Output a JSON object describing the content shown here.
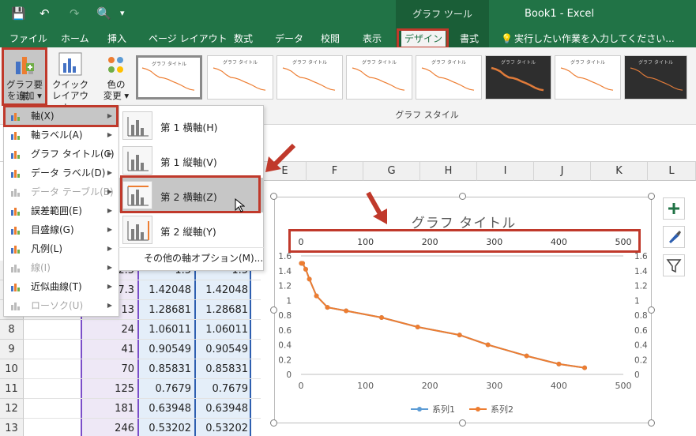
{
  "app": {
    "chart_tools_label": "グラフ ツール",
    "window_title": "Book1 - Excel",
    "qat_save": "💾",
    "qat_undo": "↶",
    "qat_redo": "↷",
    "qat_preview": "🔍",
    "qat_more": "▾"
  },
  "tabs": [
    {
      "label": "ファイル"
    },
    {
      "label": "ホーム"
    },
    {
      "label": "挿入"
    },
    {
      "label": "ページ レイアウト"
    },
    {
      "label": "数式"
    },
    {
      "label": "データ"
    },
    {
      "label": "校閲"
    },
    {
      "label": "表示"
    },
    {
      "label": "デザイン"
    },
    {
      "label": "書式"
    }
  ],
  "tell_me": "実行したい作業を入力してください...",
  "ribbon": {
    "add_element_line1": "グラフ要素",
    "add_element_line2": "を追加",
    "quick_layout_line1": "クイック",
    "quick_layout_line2": "レイアウト",
    "change_color_line1": "色の",
    "change_color_line2": "変更",
    "chart_styles_group": "グラフ スタイル",
    "thumb_title": "グラフ タイトル"
  },
  "menu": {
    "items": [
      {
        "label": "軸(X)",
        "disabled": false
      },
      {
        "label": "軸ラベル(A)",
        "disabled": false
      },
      {
        "label": "グラフ タイトル(C)",
        "disabled": false
      },
      {
        "label": "データ ラベル(D)",
        "disabled": false
      },
      {
        "label": "データ テーブル(B)",
        "disabled": true
      },
      {
        "label": "誤差範囲(E)",
        "disabled": false
      },
      {
        "label": "目盛線(G)",
        "disabled": false
      },
      {
        "label": "凡例(L)",
        "disabled": false
      },
      {
        "label": "線(I)",
        "disabled": true
      },
      {
        "label": "近似曲線(T)",
        "disabled": false
      },
      {
        "label": "ローソク(U)",
        "disabled": true
      }
    ]
  },
  "submenu": {
    "items": [
      {
        "label": "第 1 横軸(H)"
      },
      {
        "label": "第 1 縦軸(V)"
      },
      {
        "label": "第 2 横軸(Z)"
      },
      {
        "label": "第 2 縦軸(Y)"
      }
    ],
    "more_options": "その他の軸オプション(M)..."
  },
  "sheet": {
    "columns": [
      "E",
      "F",
      "G",
      "H",
      "I",
      "J",
      "K",
      "L"
    ],
    "rows": [
      {
        "num": "",
        "b": "2.5",
        "c": "1.5",
        "d": "1.5"
      },
      {
        "num": "",
        "b": "7.3",
        "c": "1.42048",
        "d": "1.42048"
      },
      {
        "num": "",
        "b": "13",
        "c": "1.28681",
        "d": "1.28681"
      },
      {
        "num": "8",
        "b": "24",
        "c": "1.06011",
        "d": "1.06011"
      },
      {
        "num": "9",
        "b": "41",
        "c": "0.90549",
        "d": "0.90549"
      },
      {
        "num": "10",
        "b": "70",
        "c": "0.85831",
        "d": "0.85831"
      },
      {
        "num": "11",
        "b": "125",
        "c": "0.7679",
        "d": "0.7679"
      },
      {
        "num": "12",
        "b": "181",
        "c": "0.63948",
        "d": "0.63948"
      },
      {
        "num": "13",
        "b": "246",
        "c": "0.53202",
        "d": "0.53202"
      }
    ]
  },
  "colors": {
    "excel_green": "#217346",
    "highlight_red": "#c0392b",
    "series1": "#5b9bd5",
    "series2": "#ed7d31"
  },
  "chart_data": {
    "type": "scatter",
    "title": "グラフ タイトル",
    "x_ticks_bottom": [
      "0",
      "100",
      "200",
      "300",
      "400",
      "500"
    ],
    "x_ticks_top": [
      "0",
      "100",
      "200",
      "300",
      "400",
      "500"
    ],
    "y_ticks_left": [
      "0",
      "0.2",
      "0.4",
      "0.6",
      "0.8",
      "1",
      "1.2",
      "1.4",
      "1.6"
    ],
    "y_ticks_right": [
      "0",
      "0.2",
      "0.4",
      "0.6",
      "0.8",
      "1",
      "1.2",
      "1.4",
      "1.6"
    ],
    "xlim": [
      0,
      500
    ],
    "ylim": [
      0,
      1.6
    ],
    "series": [
      {
        "name": "系列1",
        "color": "#5b9bd5",
        "x": [
          0.5,
          2.5,
          7.3,
          13,
          24,
          41,
          70,
          125,
          181,
          246,
          290,
          350,
          400,
          440
        ],
        "y": [
          1.5,
          1.5,
          1.42048,
          1.28681,
          1.06011,
          0.90549,
          0.85831,
          0.7679,
          0.63948,
          0.53202,
          0.4,
          0.25,
          0.14,
          0.09
        ]
      },
      {
        "name": "系列2",
        "color": "#ed7d31",
        "x": [
          0.5,
          2.5,
          7.3,
          13,
          24,
          41,
          70,
          125,
          181,
          246,
          290,
          350,
          400,
          440
        ],
        "y": [
          1.5,
          1.5,
          1.42048,
          1.28681,
          1.06011,
          0.90549,
          0.85831,
          0.7679,
          0.63948,
          0.53202,
          0.4,
          0.25,
          0.14,
          0.09
        ]
      }
    ],
    "legend_position": "bottom"
  }
}
